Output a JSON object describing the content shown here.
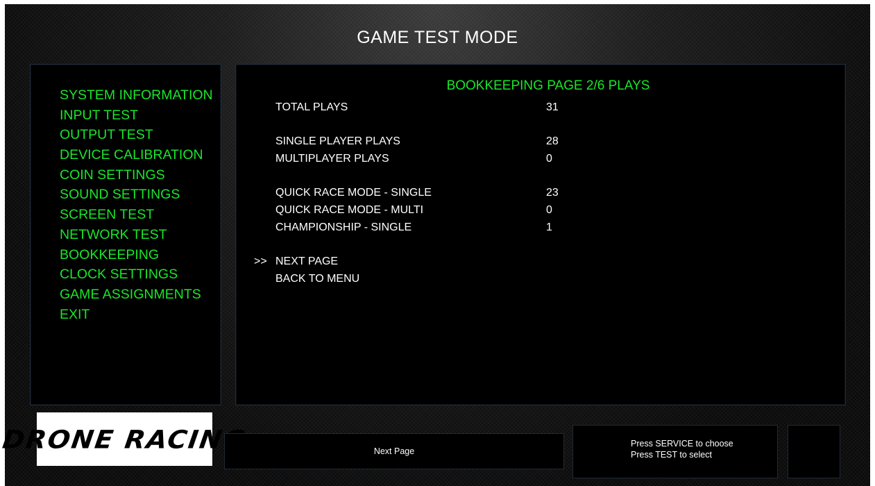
{
  "title": "GAME TEST MODE",
  "menu": {
    "items": [
      "SYSTEM INFORMATION",
      "INPUT TEST",
      "OUTPUT TEST",
      "DEVICE CALIBRATION",
      "COIN SETTINGS",
      "SOUND SETTINGS",
      "SCREEN TEST",
      "NETWORK TEST",
      "BOOKKEEPING",
      "CLOCK SETTINGS",
      "GAME ASSIGNMENTS",
      "EXIT"
    ]
  },
  "page": {
    "heading": "BOOKKEEPING PAGE 2/6 PLAYS",
    "stats": [
      {
        "label": "TOTAL PLAYS",
        "value": "31"
      },
      {
        "label": "SINGLE PLAYER PLAYS",
        "value": "28"
      },
      {
        "label": "MULTIPLAYER PLAYS",
        "value": "0"
      },
      {
        "label": "QUICK RACE MODE - SINGLE",
        "value": "23"
      },
      {
        "label": "QUICK RACE MODE - MULTI",
        "value": "0"
      },
      {
        "label": "CHAMPIONSHIP - SINGLE",
        "value": "1"
      }
    ],
    "cursor": ">>",
    "actions": [
      "NEXT PAGE",
      "BACK TO MENU"
    ]
  },
  "footer": {
    "logo_text": "DRONE RACING",
    "help_text": "Next Page",
    "instructions": [
      "Press SERVICE to choose",
      "Press TEST to select"
    ]
  },
  "colors": {
    "menu_text": "#19e62a",
    "heading_text": "#19e62a",
    "body_text": "#ffffff",
    "panel_bg": "#000000"
  }
}
